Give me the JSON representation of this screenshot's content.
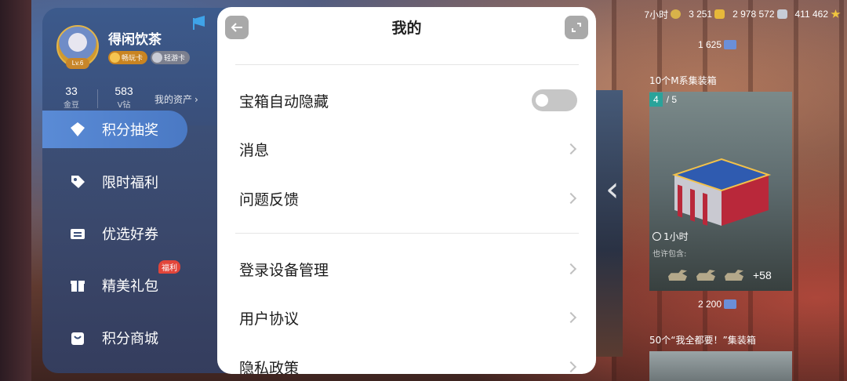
{
  "topbar": {
    "time_value": "7小时",
    "gold_value": "3 251",
    "silver_value": "2 978 572",
    "xp_value": "411 462"
  },
  "side_panel": {
    "first_count": "1 625",
    "crate_title": "10个M系集装箱",
    "crate_progress_current": "4",
    "crate_progress_sep": "/",
    "crate_progress_total": "5",
    "timer": "1小时",
    "maybe_contains": "也许包含:",
    "more_count": "+58",
    "crate_price": "2 200",
    "next_crate_title": "50个“我全都要！”集装箱"
  },
  "drawer": {
    "username": "得闲饮茶",
    "level": "Lv.6",
    "tag_1": "畅玩卡",
    "tag_2": "轻游卡",
    "stats": [
      {
        "value": "33",
        "label": "金豆"
      },
      {
        "value": "583",
        "label": "V钻"
      }
    ],
    "assets_link": "我的资产",
    "items": [
      {
        "label": "积分抽奖",
        "icon": "diamond-icon"
      },
      {
        "label": "限时福利",
        "icon": "tag-icon"
      },
      {
        "label": "优选好券",
        "icon": "ticket-icon"
      },
      {
        "label": "精美礼包",
        "icon": "gift-icon"
      },
      {
        "label": "积分商城",
        "icon": "shop-bag-icon"
      }
    ],
    "hot_badge": "福利"
  },
  "sheet": {
    "title": "我的",
    "rows": [
      {
        "label": "宝箱自动隐藏",
        "type": "toggle",
        "on": false
      },
      {
        "label": "消息",
        "type": "link"
      },
      {
        "label": "问题反馈",
        "type": "link"
      },
      {
        "label": "登录设备管理",
        "type": "link"
      },
      {
        "label": "用户协议",
        "type": "link"
      },
      {
        "label": "隐私政策",
        "type": "link"
      }
    ]
  },
  "colors": {
    "drawer_bg": "#3e5680",
    "active_nav": "#5a8bd6",
    "toggle_off": "#c6c6c6",
    "hot_badge": "#e2453a"
  }
}
